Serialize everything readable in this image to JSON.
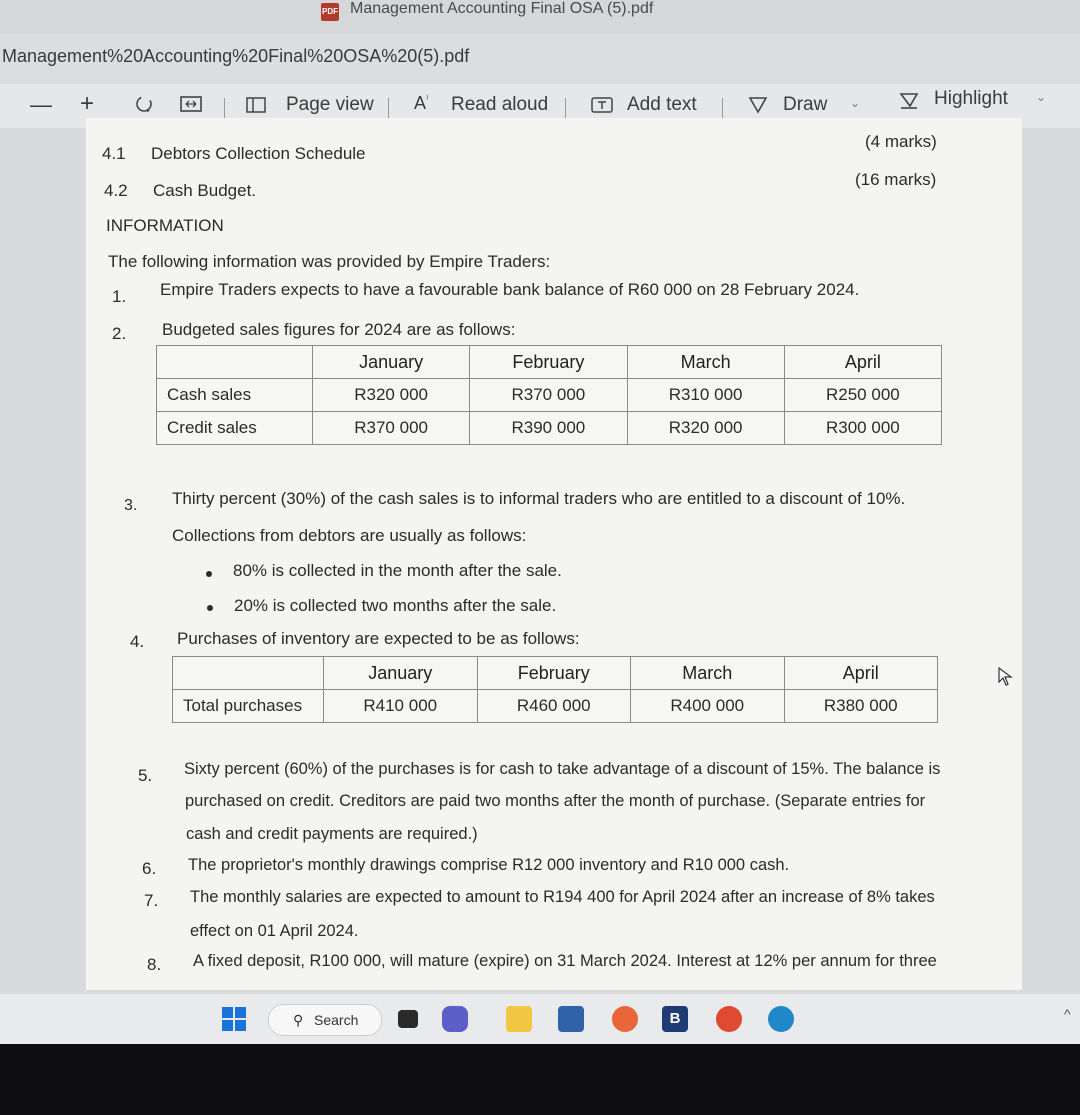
{
  "window": {
    "title": "Management Accounting Final OSA (5).pdf"
  },
  "tab": {
    "document_name": "Management%20Accounting%20Final%20OSA%20(5).pdf"
  },
  "toolbar": {
    "zoom_out": "—",
    "zoom_in": "+",
    "page_view": "Page view",
    "read_aloud": "Read aloud",
    "add_text": "Add text",
    "draw": "Draw",
    "highlight": "Highlight"
  },
  "doc": {
    "q41_num": "4.1",
    "q41_label": "Debtors Collection Schedule",
    "q41_marks": "(4 marks)",
    "q42_num": "4.2",
    "q42_label": "Cash Budget.",
    "q42_marks": "(16 marks)",
    "info_heading": "INFORMATION",
    "intro": "The following information was provided by Empire Traders:",
    "item1_num": "1.",
    "item1": "Empire Traders expects to have a favourable bank balance of R60 000 on 28 February 2024.",
    "item2_num": "2.",
    "item2": "Budgeted sales figures for 2024 are as follows:",
    "sales_table": {
      "headers": [
        "January",
        "February",
        "March",
        "April"
      ],
      "rows": [
        {
          "label": "Cash sales",
          "values": [
            "R320 000",
            "R370 000",
            "R310 000",
            "R250 000"
          ]
        },
        {
          "label": "Credit sales",
          "values": [
            "R370 000",
            "R390 000",
            "R320 000",
            "R300 000"
          ]
        }
      ]
    },
    "item3_num": "3.",
    "item3_line1": "Thirty percent (30%) of the cash sales is to informal traders who are entitled to a discount of 10%.",
    "item3_line2": "Collections from debtors are usually as follows:",
    "bullet1": "80% is collected in the month after the sale.",
    "bullet2": "20% is collected two months after the sale.",
    "item4_num": "4.",
    "item4": "Purchases of inventory are expected to be as follows:",
    "purchases_table": {
      "headers": [
        "January",
        "February",
        "March",
        "April"
      ],
      "rows": [
        {
          "label": "Total purchases",
          "values": [
            "R410 000",
            "R460 000",
            "R400 000",
            "R380 000"
          ]
        }
      ]
    },
    "item5_num": "5.",
    "item5_line1": "Sixty percent (60%) of the purchases is for cash to take advantage of a discount of 15%.  The balance is",
    "item5_line2": "purchased on credit.  Creditors are paid two months after the month of purchase. (Separate entries for",
    "item5_line3": "cash and credit payments are required.)",
    "item6_num": "6.",
    "item6": "The proprietor's monthly drawings comprise R12 000 inventory and R10 000 cash.",
    "item7_num": "7.",
    "item7_line1": "The monthly salaries are expected to amount to R194 400 for April 2024 after an increase of 8% takes",
    "item7_line2": "effect on 01 April 2024.",
    "item8_num": "8.",
    "item8": "A fixed deposit, R100 000, will mature (expire) on 31 March 2024.  Interest at 12% per annum for three"
  },
  "taskbar": {
    "search_label": "Search"
  },
  "colors": {
    "accent_pdf": "#b23b2e",
    "windows_blue": "#1a73d9"
  }
}
